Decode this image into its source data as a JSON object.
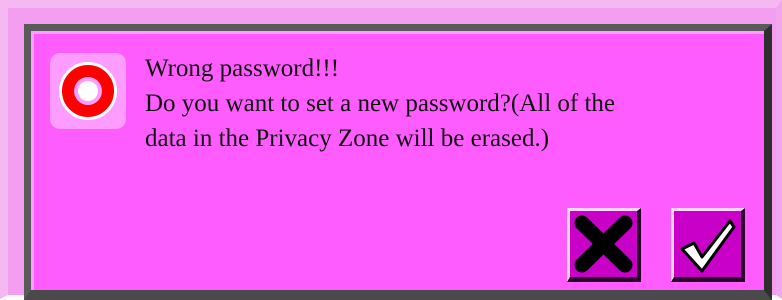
{
  "dialog": {
    "lines": [
      "Wrong password!!!",
      "Do you want to set a new password?(All of the",
      "data in the Privacy Zone will be erased.)"
    ],
    "icon": "warning-ring-icon",
    "buttons": {
      "cancel_icon": "x-icon",
      "confirm_icon": "check-icon"
    },
    "colors": {
      "background": "#ff5cff",
      "button": "#c800c8",
      "warning_ring": "#ff0000"
    }
  }
}
